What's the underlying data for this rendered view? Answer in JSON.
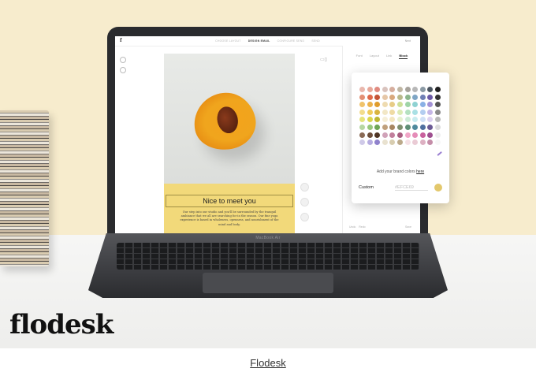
{
  "editor": {
    "logo_letter": "f",
    "steps": [
      "CHOOSE LAYOUT",
      "DESIGN EMAIL",
      "CONFIGURE SEND",
      "SEND"
    ],
    "active_step_index": 1,
    "next_label": "Next",
    "panel_tabs": [
      "Font",
      "Layout",
      "Link",
      "Block"
    ],
    "active_tab": "Block",
    "headline": "Nice to meet you",
    "body_copy": "Our step into our studio and you'll be surrounded by the tranquil ambiance that we all are searching for in the season. Our fine yoga experience is based in wholeness, openness, and nourishment of the mind and body.",
    "undo_label": "Undo",
    "redo_label": "Redo",
    "save_label": "Save"
  },
  "color_popover": {
    "brand_text": "Add your brand colors",
    "brand_link": "here",
    "custom_label": "Custom",
    "hex_value": "#EFCE69",
    "custom_color": "#E3C86C",
    "palette": [
      [
        "#e9b7ad",
        "#e7a89a",
        "#e08a7f",
        "#d9c3bd",
        "#d6ae9e",
        "#bfb6a3",
        "#a7a39c",
        "#b7b7b7",
        "#8b9aa5",
        "#4b5560",
        "#1f1f1f"
      ],
      [
        "#e38f74",
        "#df6a4a",
        "#c45436",
        "#e6c7a7",
        "#d9a87c",
        "#b9b98b",
        "#8cb58c",
        "#7fa6c5",
        "#6f7fb5",
        "#6c5aa6",
        "#333333"
      ],
      [
        "#f0c36b",
        "#ebb34d",
        "#e09d2c",
        "#eedbb0",
        "#e7cc86",
        "#cddf97",
        "#9fd4a6",
        "#8fd2d2",
        "#8ab1e5",
        "#a393d6",
        "#555555"
      ],
      [
        "#f3dd8c",
        "#efcc5c",
        "#d9b43e",
        "#f2e7c6",
        "#efdba3",
        "#dcebb4",
        "#b5e1c0",
        "#a9e0e4",
        "#b3cdf0",
        "#c5b6e6",
        "#8a8a8a"
      ],
      [
        "#e7e47a",
        "#dbd64d",
        "#bdb632",
        "#f6efd8",
        "#f3e6bf",
        "#e7f1cf",
        "#cdebd6",
        "#c8ecef",
        "#d0e0f6",
        "#dcd1f0",
        "#b9b9b9"
      ],
      [
        "#b7d7a1",
        "#98c77c",
        "#6fa656",
        "#c0a07d",
        "#a78661",
        "#7f8f6f",
        "#5f8f76",
        "#4f8a9d",
        "#4f6f9f",
        "#6b5a94",
        "#dcdcdc"
      ],
      [
        "#8a6a55",
        "#6e4f3c",
        "#4f3424",
        "#d0a2b8",
        "#c17f9c",
        "#a85e80",
        "#f1a7c8",
        "#e58cb8",
        "#c9609d",
        "#9e4f8f",
        "#efefef"
      ],
      [
        "#cfc9e8",
        "#b6ace0",
        "#8f82cc",
        "#e9e2d0",
        "#d8cdb0",
        "#bba98a",
        "#f5e1e6",
        "#eacbd5",
        "#ddb0c2",
        "#c48da8",
        "#f7f7f7"
      ]
    ]
  },
  "hinge_label": "MacBook Air",
  "brand_logo": "flodesk",
  "caption": "Flodesk"
}
